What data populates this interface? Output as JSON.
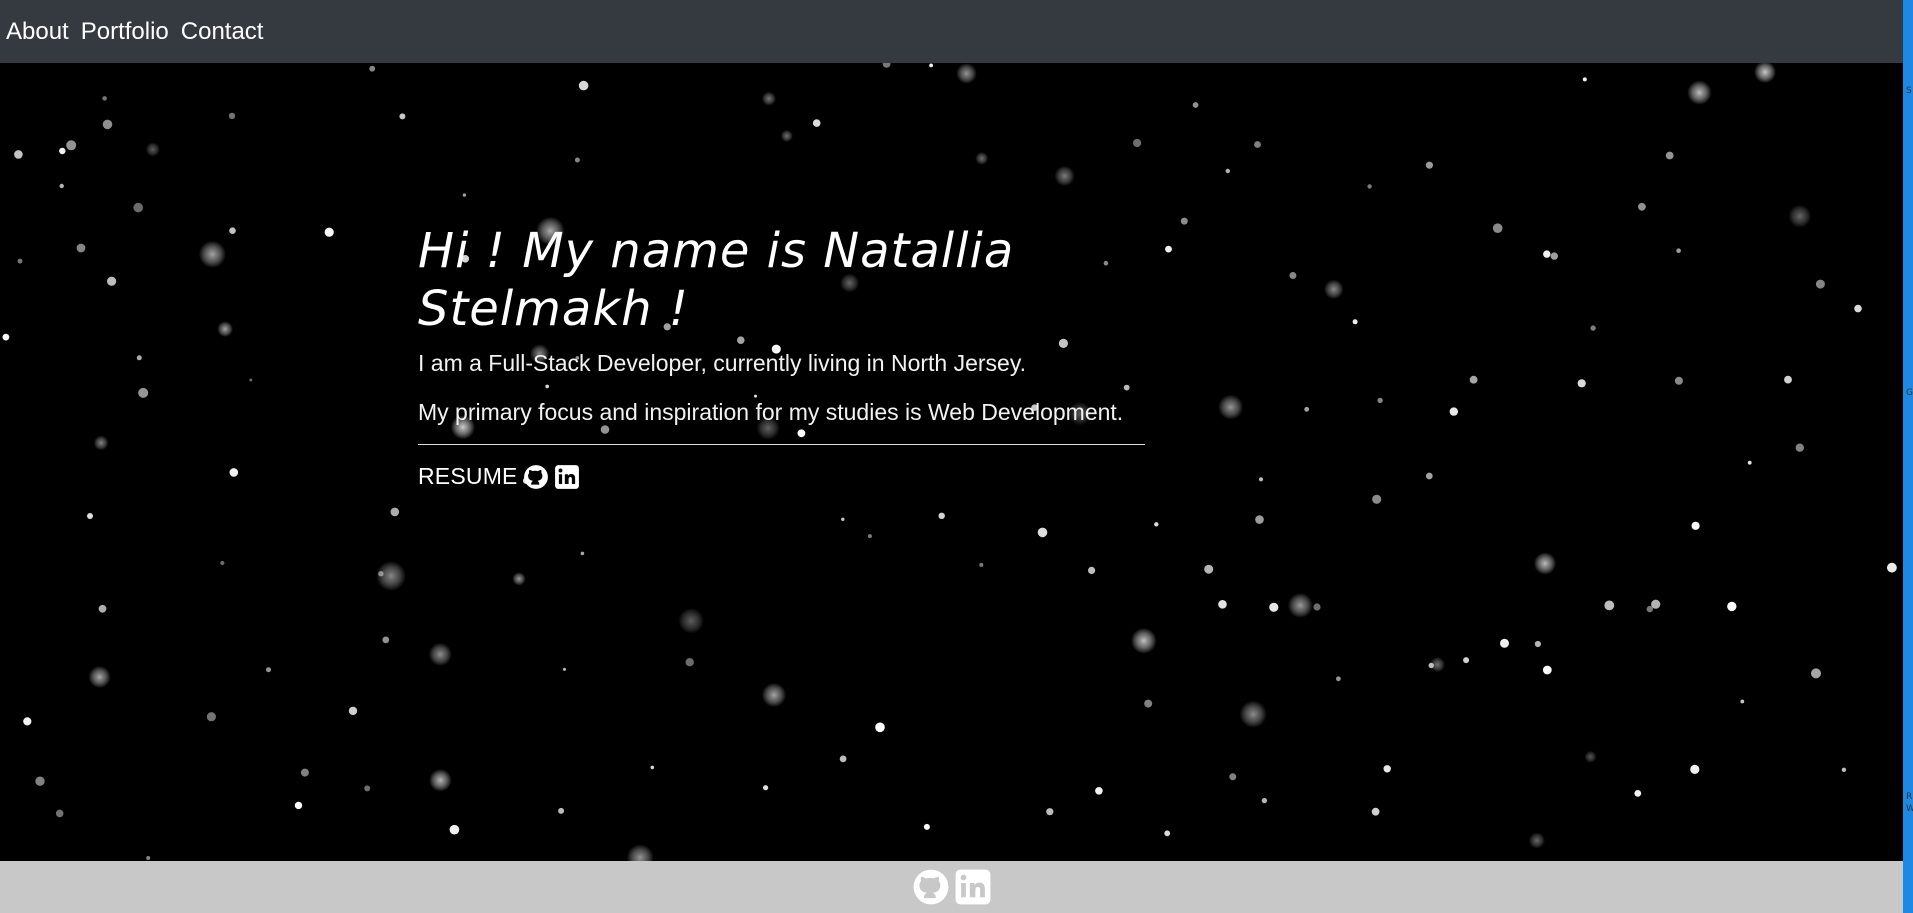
{
  "nav": {
    "items": [
      {
        "label": "About"
      },
      {
        "label": "Portfolio"
      },
      {
        "label": "Contact"
      }
    ]
  },
  "hero": {
    "headline": "Hi ! My name is Natallia Stelmakh !",
    "line1": "I am a Full-Stack Developer, currently living in North Jersey.",
    "line2": "My primary focus and inspiration for my studies is Web Development.",
    "resume_label": "RESUME",
    "icons": [
      "github-icon",
      "linkedin-icon"
    ]
  },
  "footer": {
    "icons": [
      "github-icon",
      "linkedin-icon"
    ]
  },
  "colors": {
    "navbar_bg": "#343a40",
    "hero_bg": "#000000",
    "footer_bg": "#c8c8c8",
    "text": "#ffffff",
    "right_strip": "#1e88e5"
  },
  "edge_marks": [
    "S",
    "G",
    "R",
    "W"
  ]
}
